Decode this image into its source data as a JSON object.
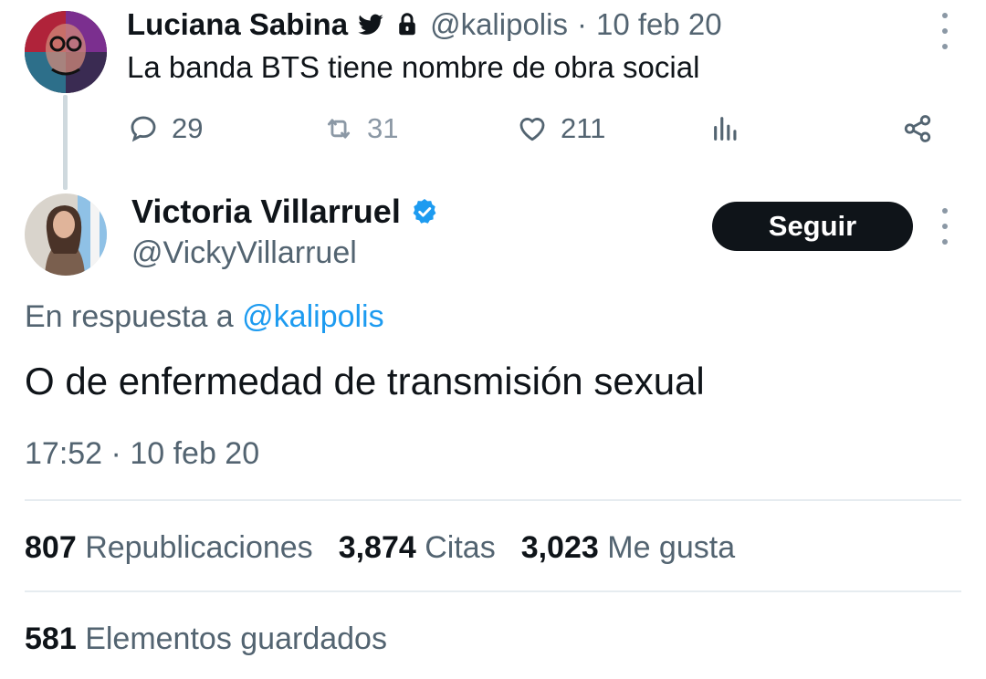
{
  "parent_tweet": {
    "display_name": "Luciana Sabina",
    "handle": "@kalipolis",
    "separator": "·",
    "date": "10 feb 20",
    "text": "La banda BTS tiene nombre de obra social",
    "icons": [
      "twitter-bird-icon",
      "lock-icon",
      "more-vertical-icon"
    ],
    "actions": {
      "replies": "29",
      "retweets": "31",
      "likes": "211"
    },
    "action_icons": [
      "reply-icon",
      "retweet-icon",
      "like-icon",
      "views-icon",
      "share-icon"
    ]
  },
  "main_tweet": {
    "display_name": "Victoria Villarruel",
    "handle": "@VickyVillarruel",
    "verified_icon": "verified-badge-icon",
    "follow_label": "Seguir",
    "reply_prefix": "En respuesta a",
    "reply_handle": "@kalipolis",
    "text": "O de enfermedad de transmisión sexual",
    "time": "17:52",
    "separator": "·",
    "date": "10 feb 20",
    "stats": [
      {
        "value": "807",
        "label": "Republicaciones"
      },
      {
        "value": "3,874",
        "label": "Citas"
      },
      {
        "value": "3,023",
        "label": "Me gusta"
      }
    ],
    "bookmarks": {
      "value": "581",
      "label": "Elementos guardados"
    }
  },
  "colors": {
    "text_primary": "#0f1419",
    "text_secondary": "#536471",
    "link": "#1d9bf0",
    "verified": "#1d9bf0",
    "button_bg": "#0f1419",
    "divider": "#e6ecf0"
  }
}
